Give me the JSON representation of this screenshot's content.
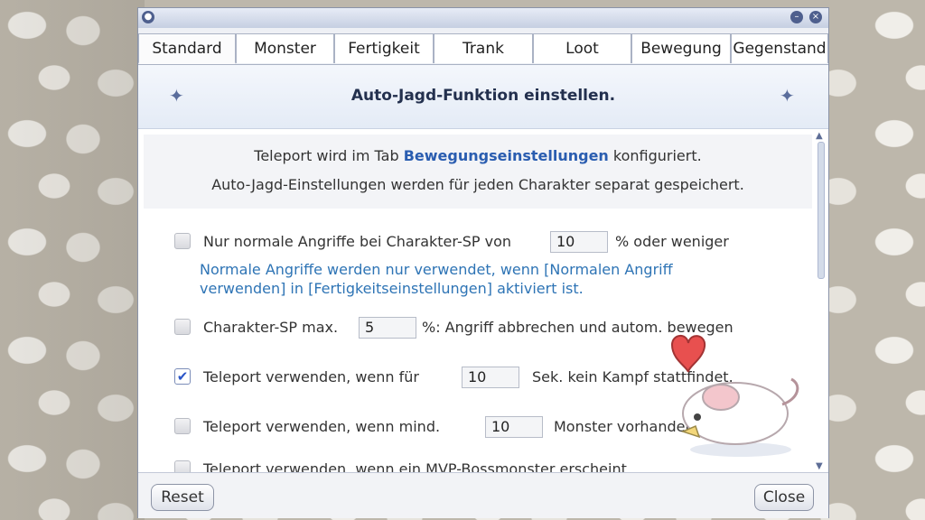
{
  "window": {
    "title_icon": "circle-icon",
    "controls": [
      "minimize-icon",
      "close-icon"
    ]
  },
  "tabs": [
    {
      "label": "Standard",
      "active": true
    },
    {
      "label": "Monster"
    },
    {
      "label": "Fertigkeit"
    },
    {
      "label": "Trank"
    },
    {
      "label": "Loot"
    },
    {
      "label": "Bewegung"
    },
    {
      "label": "Gegenstand"
    }
  ],
  "header": {
    "title": "Auto-Jagd-Funktion einstellen."
  },
  "info": {
    "line1_prefix": "Teleport wird im Tab ",
    "line1_link": "Bewegungseinstellungen",
    "line1_suffix": " konfiguriert.",
    "line2": "Auto-Jagd-Einstellungen werden für jeden Charakter separat gespeichert."
  },
  "options": [
    {
      "checked": false,
      "before": "Nur normale Angriffe bei Charakter-SP von",
      "value": "10",
      "after": "% oder weniger",
      "note_line1": "Normale Angriffe werden nur verwendet, wenn [Normalen Angriff",
      "note_line2": "verwenden] in [Fertigkeitseinstellungen] aktiviert ist."
    },
    {
      "checked": false,
      "before": "Charakter-SP max.",
      "value": "5",
      "after": "%: Angriff abbrechen und autom. bewegen"
    },
    {
      "checked": true,
      "before": "Teleport verwenden, wenn für",
      "value": "10",
      "after": "Sek. kein Kampf stattfindet."
    },
    {
      "checked": false,
      "before": "Teleport verwenden, wenn mind.",
      "value": "10",
      "after": "Monster vorhanden sind."
    },
    {
      "checked": false,
      "before": "Teleport verwenden, wenn ein MVP-Bossmonster erscheint."
    }
  ],
  "footer": {
    "reset_label": "Reset",
    "close_label": "Close"
  },
  "colors": {
    "accent": "#2a5db0",
    "note": "#2e74b5",
    "titlebar": "#c6cfe2"
  }
}
